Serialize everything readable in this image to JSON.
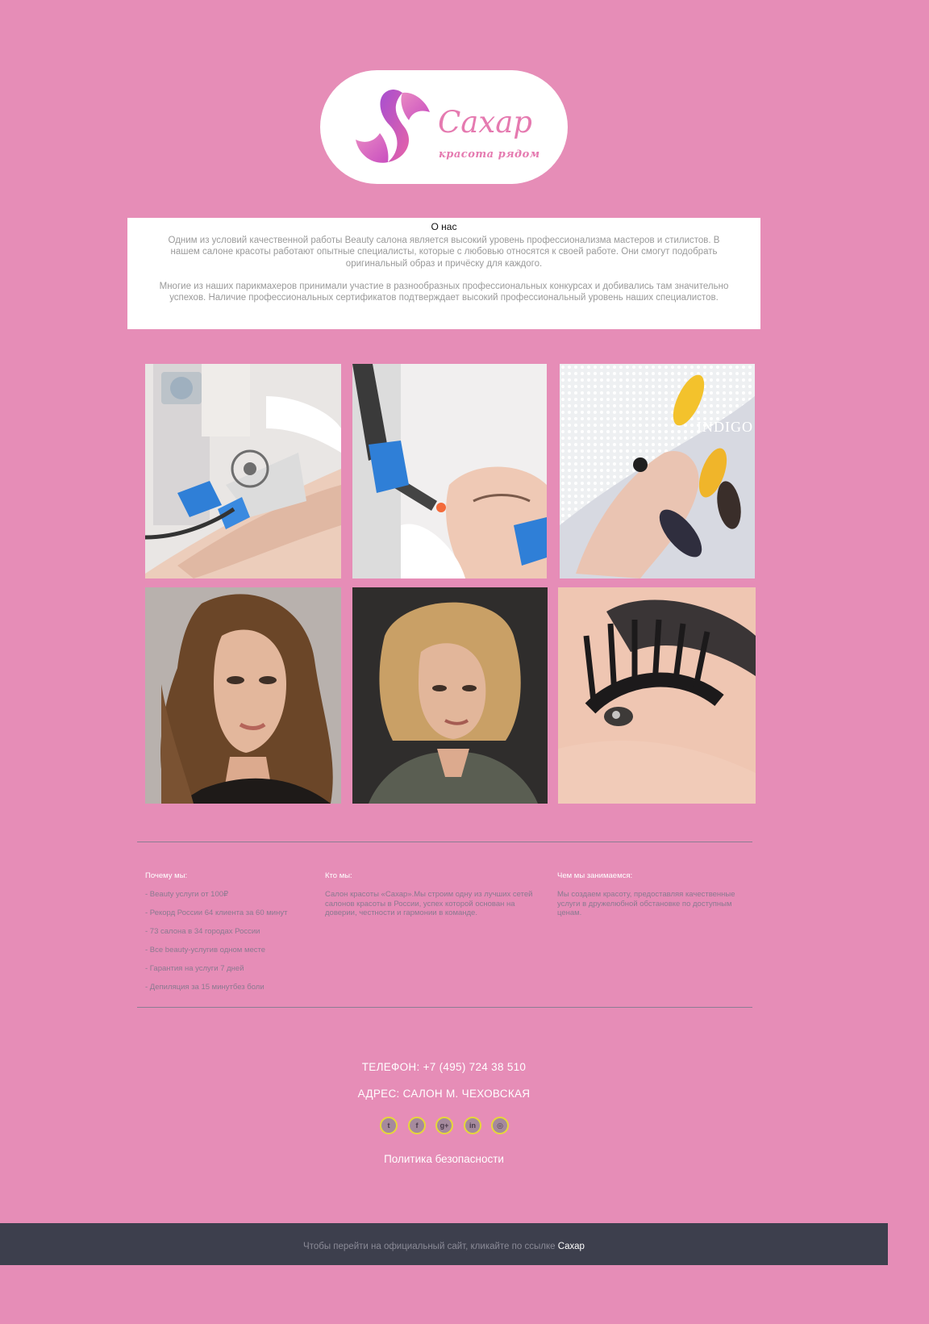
{
  "logo": {
    "title": "Сахар",
    "tagline": "красота рядом",
    "mark_colors": [
      "#b94fc9",
      "#e560a8"
    ]
  },
  "about": {
    "title": "О нас",
    "paragraph_1": "Одним из условий качественной работы Beauty салона является высокий уровень профессионализма мастеров и стилистов. В нашем салоне красоты работают опытные специалисты, которые с любовью относятся к своей работе. Они смогут подобрать оригинальный образ и причёску для каждого.",
    "paragraph_2": "Многие из наших парикмахеров принимали участие в разнообразных профессиональных конкурсах и добивались там значительно успехов. Наличие профессиональных сертификатов подтверждает высокий профессиональный уровень наших специалистов."
  },
  "gallery": {
    "tiles": [
      {
        "subject": "laser-hair-removal-photo"
      },
      {
        "subject": "facial-laser-treatment-photo"
      },
      {
        "subject": "manicure-nails-photo",
        "overlay_text": "INDIGO"
      },
      {
        "subject": "evening-makeup-portrait-photo"
      },
      {
        "subject": "short-curly-hairstyle-portrait-photo"
      },
      {
        "subject": "eyelash-and-brow-closeup-photo"
      }
    ]
  },
  "info": {
    "why": {
      "heading": "Почему мы:",
      "items": [
        "- Beauty услуги от 100₽",
        "- Рекорд России 64 клиента за 60 минут",
        "- 73 салона в 34 городах России",
        "- Все beauty-услугив одном месте",
        "- Гарантия на услуги 7 дней",
        "- Депиляция за 15 минутбез боли"
      ]
    },
    "who": {
      "heading": "Кто мы:",
      "text": "Салон красоты «Сахар».Мы строим одну из лучших сетей салонов красоты в России, успех которой основан на доверии, честности и гармонии в команде."
    },
    "what": {
      "heading": "Чем мы занимаемся:",
      "text": "Мы создаем красоту, предоставляя качественные услуги в дружелюбной обстановке по доступным ценам."
    }
  },
  "contacts": {
    "phone": "ТЕЛЕФОН: +7 (495) 724 38 510",
    "address": "АДРЕС: САЛОН М. ЧЕХОВСКАЯ",
    "socials": [
      {
        "icon": "twitter-icon",
        "glyph": "t"
      },
      {
        "icon": "facebook-icon",
        "glyph": "f"
      },
      {
        "icon": "google-plus-icon",
        "glyph": "g+"
      },
      {
        "icon": "linkedin-icon",
        "glyph": "in"
      },
      {
        "icon": "instagram-icon",
        "glyph": "◎"
      }
    ],
    "policy": "Политика безопасности"
  },
  "footer": {
    "text": "Чтобы перейти на официальный сайт, кликайте по ссылке ",
    "link": "Сахар"
  },
  "colors": {
    "page_background": "#e68db7",
    "footer_background": "#3d3f4d",
    "social_ring": "#e6d73a"
  }
}
